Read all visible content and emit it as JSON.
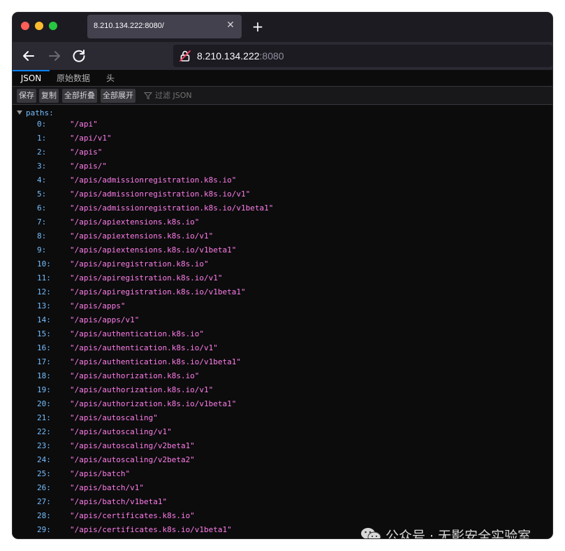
{
  "browser": {
    "tab_title": "8.210.134.222:8080/",
    "tab_close_icon": "close-icon",
    "new_tab_icon": "plus-icon",
    "url_host": "8.210.134.222",
    "url_port": ":8080"
  },
  "viewer": {
    "tabs": [
      "JSON",
      "原始数据",
      "头"
    ],
    "toolbar": {
      "save": "保存",
      "copy": "复制",
      "collapse_all": "全部折叠",
      "expand_all": "全部展开",
      "filter_placeholder": "过滤 JSON"
    }
  },
  "json": {
    "root_key": "paths:",
    "items": [
      {
        "index": "0:",
        "value": "\"/api\""
      },
      {
        "index": "1:",
        "value": "\"/api/v1\""
      },
      {
        "index": "2:",
        "value": "\"/apis\""
      },
      {
        "index": "3:",
        "value": "\"/apis/\""
      },
      {
        "index": "4:",
        "value": "\"/apis/admissionregistration.k8s.io\""
      },
      {
        "index": "5:",
        "value": "\"/apis/admissionregistration.k8s.io/v1\""
      },
      {
        "index": "6:",
        "value": "\"/apis/admissionregistration.k8s.io/v1beta1\""
      },
      {
        "index": "7:",
        "value": "\"/apis/apiextensions.k8s.io\""
      },
      {
        "index": "8:",
        "value": "\"/apis/apiextensions.k8s.io/v1\""
      },
      {
        "index": "9:",
        "value": "\"/apis/apiextensions.k8s.io/v1beta1\""
      },
      {
        "index": "10:",
        "value": "\"/apis/apiregistration.k8s.io\""
      },
      {
        "index": "11:",
        "value": "\"/apis/apiregistration.k8s.io/v1\""
      },
      {
        "index": "12:",
        "value": "\"/apis/apiregistration.k8s.io/v1beta1\""
      },
      {
        "index": "13:",
        "value": "\"/apis/apps\""
      },
      {
        "index": "14:",
        "value": "\"/apis/apps/v1\""
      },
      {
        "index": "15:",
        "value": "\"/apis/authentication.k8s.io\""
      },
      {
        "index": "16:",
        "value": "\"/apis/authentication.k8s.io/v1\""
      },
      {
        "index": "17:",
        "value": "\"/apis/authentication.k8s.io/v1beta1\""
      },
      {
        "index": "18:",
        "value": "\"/apis/authorization.k8s.io\""
      },
      {
        "index": "19:",
        "value": "\"/apis/authorization.k8s.io/v1\""
      },
      {
        "index": "20:",
        "value": "\"/apis/authorization.k8s.io/v1beta1\""
      },
      {
        "index": "21:",
        "value": "\"/apis/autoscaling\""
      },
      {
        "index": "22:",
        "value": "\"/apis/autoscaling/v1\""
      },
      {
        "index": "23:",
        "value": "\"/apis/autoscaling/v2beta1\""
      },
      {
        "index": "24:",
        "value": "\"/apis/autoscaling/v2beta2\""
      },
      {
        "index": "25:",
        "value": "\"/apis/batch\""
      },
      {
        "index": "26:",
        "value": "\"/apis/batch/v1\""
      },
      {
        "index": "27:",
        "value": "\"/apis/batch/v1beta1\""
      },
      {
        "index": "28:",
        "value": "\"/apis/certificates.k8s.io\""
      },
      {
        "index": "29:",
        "value": "\"/apis/certificates.k8s.io/v1beta1\""
      }
    ]
  },
  "watermark": {
    "text": "公众号 · 无影安全实验室",
    "icon": "wechat-icon"
  }
}
